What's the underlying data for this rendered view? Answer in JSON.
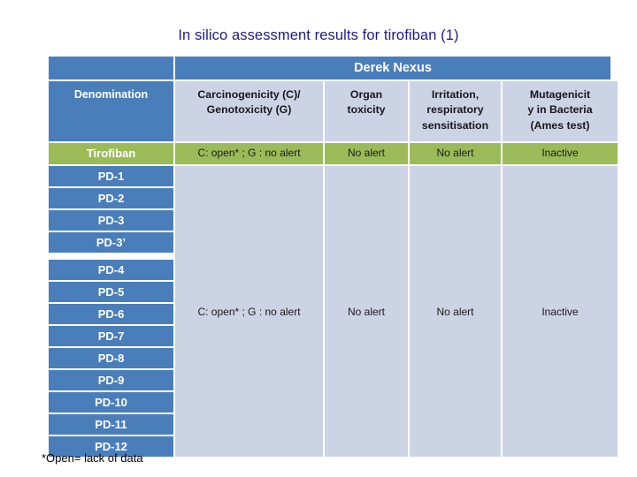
{
  "slide": {
    "title": "In silico assessment results for tirofiban (1)",
    "title_color": "#1f1a8c",
    "footnote": "*Open= lack of data"
  },
  "colors": {
    "header_blue": "#4a7ebb",
    "row_green": "#9bbb59",
    "cell_light": "#ccd3e5",
    "white": "#ffffff"
  },
  "table": {
    "banner": {
      "blank_label": "",
      "group_label": "Derek Nexus"
    },
    "columns": [
      "Denomination",
      "Carcinogenicity (C)/ Genotoxicity (G)",
      "Organ toxicity",
      "Irritation, respiratory sensitisation",
      "Mutagenicity in Bacteria (Ames test)"
    ],
    "column_headers": {
      "denomination": "Denomination",
      "carcinogenicity_line1": "Carcinogenicity (C)/",
      "carcinogenicity_line2": "Genotoxicity (G)",
      "organ_line1": "Organ",
      "organ_line2": "toxicity",
      "irritation_line1": "Irritation,",
      "irritation_line2": "respiratory",
      "irritation_line3": "sensitisation",
      "mutagenicity_line1": "Mutagenicit",
      "mutagenicity_line2": "y in Bacteria",
      "mutagenicity_line3": "(Ames test)"
    },
    "tirofiban_row": {
      "label": "Tirofiban",
      "carcinogenicity": "C: open* ; G : no alert",
      "organ_toxicity": "No alert",
      "irritation": "No alert",
      "mutagenicity": "Inactive"
    },
    "pd_rows": [
      {
        "label": "PD-1"
      },
      {
        "label": "PD-2"
      },
      {
        "label": "PD-3"
      },
      {
        "label": "PD-3’"
      },
      {
        "label": "PD-4"
      },
      {
        "label": "PD-5"
      },
      {
        "label": "PD-6"
      },
      {
        "label": "PD-7"
      },
      {
        "label": "PD-8"
      },
      {
        "label": "PD-9"
      },
      {
        "label": "PD-10"
      },
      {
        "label": "PD-11"
      },
      {
        "label": "PD-12"
      }
    ],
    "pd_group_row": {
      "carcinogenicity": "C: open* ; G : no alert",
      "organ_toxicity": "No alert",
      "irritation": "No alert",
      "mutagenicity": "Inactive"
    }
  }
}
